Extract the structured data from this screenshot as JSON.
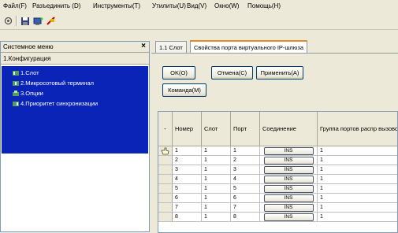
{
  "menu": {
    "file": "Файл(F)",
    "disconnect": "Разъединить (D)",
    "tools": "Инструменты(T)",
    "utilities": "Утилиты(U)",
    "view": "Вид(V)",
    "window": "Окно(W)",
    "help": "Помощь(H)"
  },
  "toolbar": {
    "icons": [
      "settings-icon",
      "save-icon",
      "connect-icon",
      "disconnect-icon"
    ]
  },
  "left_panel": {
    "title": "Системное меню",
    "close": "×",
    "root": "1.Конфигурация",
    "items": [
      {
        "label": "1.Слот",
        "icon": "slot-icon",
        "color": "#3c8c3c"
      },
      {
        "label": "2.Микросотовый терминал",
        "icon": "terminal-icon",
        "color": "#3c8c3c"
      },
      {
        "label": "3.Опции",
        "icon": "options-icon",
        "color": "#3c8c3c"
      },
      {
        "label": "4.Приоритет синхронизации",
        "icon": "sync-icon",
        "color": "#3c8c3c"
      }
    ]
  },
  "tabs": [
    {
      "label": "1.1 Слот"
    },
    {
      "label": "Свойства порта виртуального IP-шлюза"
    }
  ],
  "buttons": {
    "ok": "OK(O)",
    "cancel": "Отмена(C)",
    "apply": "Применить(A)",
    "command": "Команда(M)"
  },
  "grid": {
    "select_header": "-",
    "columns": [
      "Номер",
      "Слот",
      "Порт",
      "Соединение",
      "Группа портов распр вызовов"
    ],
    "rows": [
      {
        "number": "1",
        "slot": "1",
        "port": "1",
        "connection": "INS",
        "group": "1"
      },
      {
        "number": "2",
        "slot": "1",
        "port": "2",
        "connection": "INS",
        "group": "1"
      },
      {
        "number": "3",
        "slot": "1",
        "port": "3",
        "connection": "INS",
        "group": "1"
      },
      {
        "number": "4",
        "slot": "1",
        "port": "4",
        "connection": "INS",
        "group": "1"
      },
      {
        "number": "5",
        "slot": "1",
        "port": "5",
        "connection": "INS",
        "group": "1"
      },
      {
        "number": "6",
        "slot": "1",
        "port": "6",
        "connection": "INS",
        "group": "1"
      },
      {
        "number": "7",
        "slot": "1",
        "port": "7",
        "connection": "INS",
        "group": "1"
      },
      {
        "number": "8",
        "slot": "1",
        "port": "8",
        "connection": "INS",
        "group": "1"
      }
    ]
  }
}
